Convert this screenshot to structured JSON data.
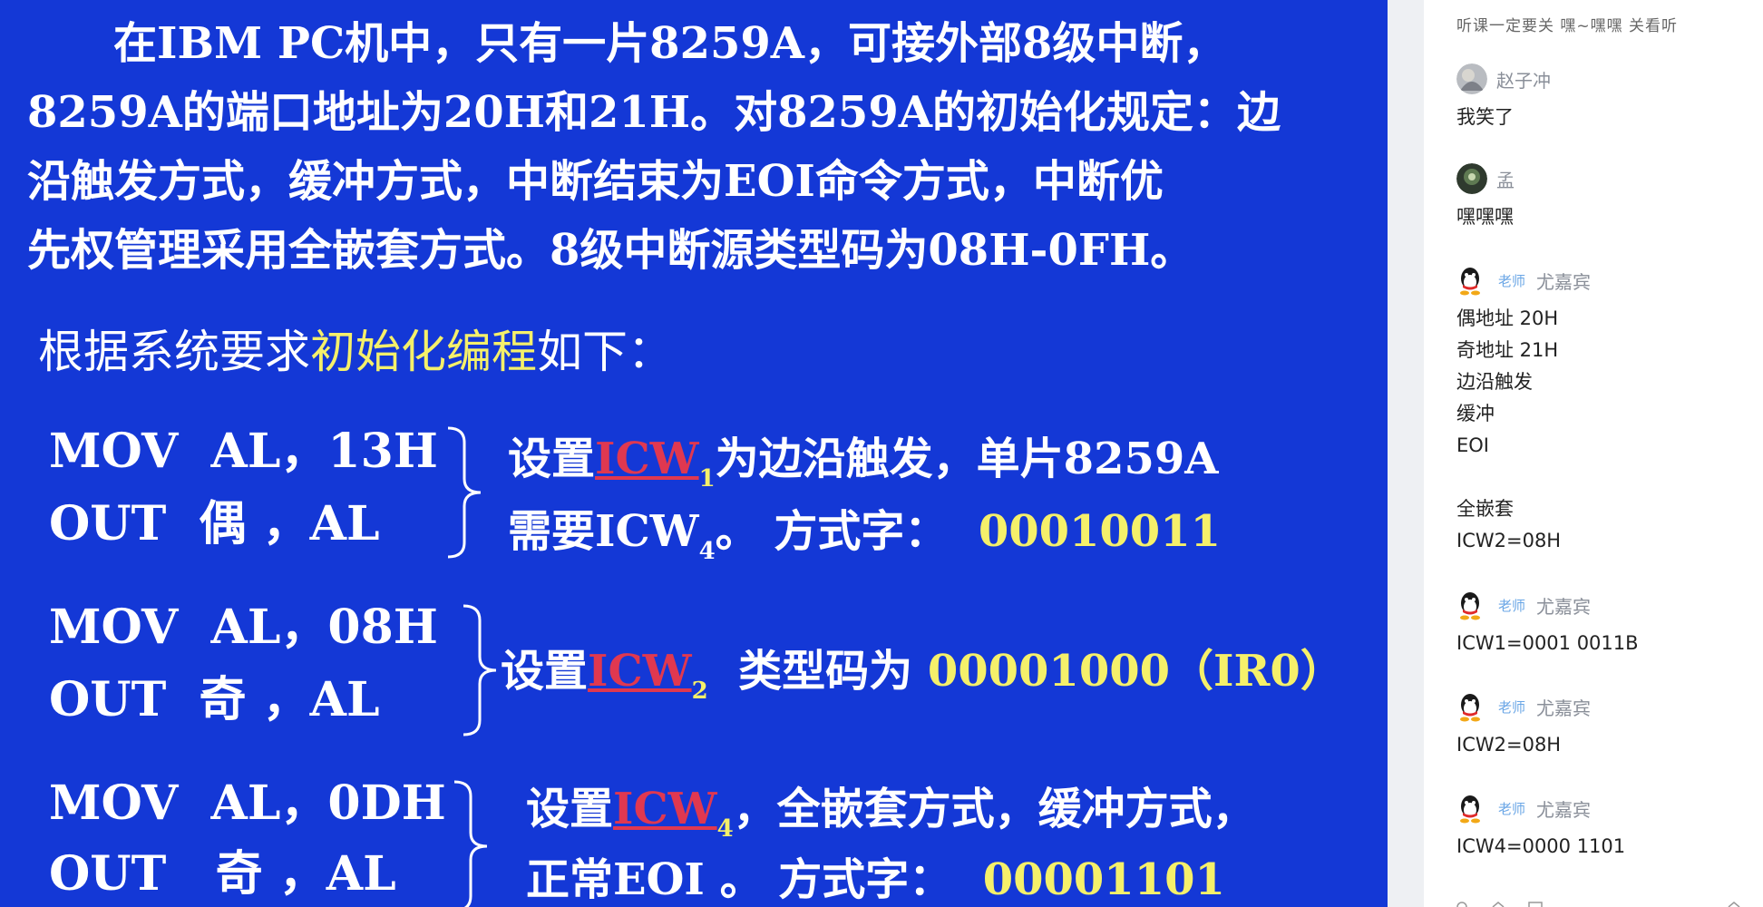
{
  "slide": {
    "paragraph": {
      "line1": [
        "在IBM PC机中，只有一片8259A，可接外部8级中断，"
      ],
      "line2": "8259A的端口地址为20H和21H。对8259A的初始化规定：边",
      "line3": "沿触发方式，缓冲方式，中断结束为EOI命令方式，中断优",
      "line4": "先权管理采用全嵌套方式。8级中断源类型码为08H-0FH。"
    },
    "intro": {
      "before": "根据系统要求",
      "highlight": "初始化编程",
      "after": "如下："
    },
    "blocks": [
      {
        "code1": "MOV  AL，13H",
        "code2": "OUT  偶 ，AL",
        "desc1_pre": "设置",
        "icw": "ICW",
        "icw_sub": "1",
        "desc1_post": "为边沿触发，单片8259A",
        "desc2_pre": "需要ICW",
        "desc2_sub": "4",
        "desc2_post": "。 方式字：",
        "value": "00010011"
      },
      {
        "code1": "MOV  AL，08H",
        "code2": "OUT  奇 ，AL",
        "desc1_pre": "设置",
        "icw": "ICW",
        "icw_sub": "2",
        "desc1_post": "类型码为",
        "value": "00001000（IR0）"
      },
      {
        "code1": "MOV  AL，0DH",
        "code2": "OUT   奇 ，AL",
        "desc1_pre": "设置",
        "icw": "ICW",
        "icw_sub": "4",
        "desc1_post": "，全嵌套方式，缓冲方式，",
        "desc2_pre": "正常EOI 。 方式字：",
        "value": "00001101"
      }
    ]
  },
  "chat": {
    "cut_top_text": "听课一定要关 嘿~嘿嘿 关看听",
    "messages": [
      {
        "name": "赵子冲",
        "role": "",
        "text": "我笑了",
        "avatar": "photo"
      },
      {
        "name": "孟",
        "role": "",
        "text": "嘿嘿嘿",
        "avatar": "dark"
      },
      {
        "name": "尤嘉宾",
        "role": "老师",
        "text": "偶地址 20H\n奇地址 21H\n边沿触发\n缓冲\nEOI\n\n全嵌套\nICW2=08H",
        "avatar": "qq"
      },
      {
        "name": "尤嘉宾",
        "role": "老师",
        "text": "ICW1=0001 0011B",
        "avatar": "qq"
      },
      {
        "name": "尤嘉宾",
        "role": "老师",
        "text": "ICW2=08H",
        "avatar": "qq"
      },
      {
        "name": "尤嘉宾",
        "role": "老师",
        "text": "ICW4=0000 1101",
        "avatar": "qq"
      }
    ]
  },
  "colors": {
    "slide_bg": "#1438d6",
    "highlight": "#f5f06a",
    "icw_red": "#e03850",
    "role_blue": "#6aa6e6"
  }
}
